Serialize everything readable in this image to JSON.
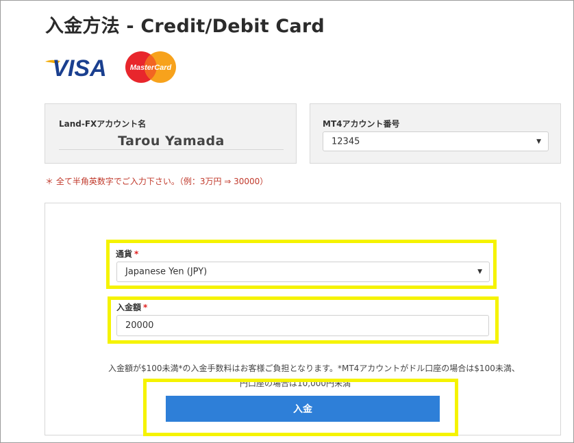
{
  "page": {
    "title": "入金方法 - Credit/Debit Card"
  },
  "logos": {
    "visa": "VISA",
    "mastercard": "MasterCard"
  },
  "account": {
    "label": "Land-FXアカウント名",
    "name": "Tarou Yamada"
  },
  "mt4": {
    "label": "MT4アカウント番号",
    "selected": "12345"
  },
  "notice": "＊ 全て半角英数字でご入力下さい。（例：3万円 ⇒ 30000）",
  "form": {
    "currency": {
      "label": "通貨",
      "required_mark": "*",
      "selected": "Japanese Yen (JPY)"
    },
    "amount": {
      "label": "入金額",
      "required_mark": "*",
      "value": "20000"
    },
    "fee_note": "入金額が$100未満*の入金手数料はお客様ご負担となります。*MT4アカウントがドル口座の場合は$100未満、",
    "fee_note_2": "円口座の場合は10,000円未満",
    "submit_label": "入金"
  },
  "colors": {
    "accent": "#2e7fd8",
    "highlight": "#f5f300",
    "required": "#e02020",
    "notice": "#c0392b",
    "panel_bg": "#f2f2f2"
  },
  "icons": {
    "dropdown": "chevron-down-icon"
  }
}
